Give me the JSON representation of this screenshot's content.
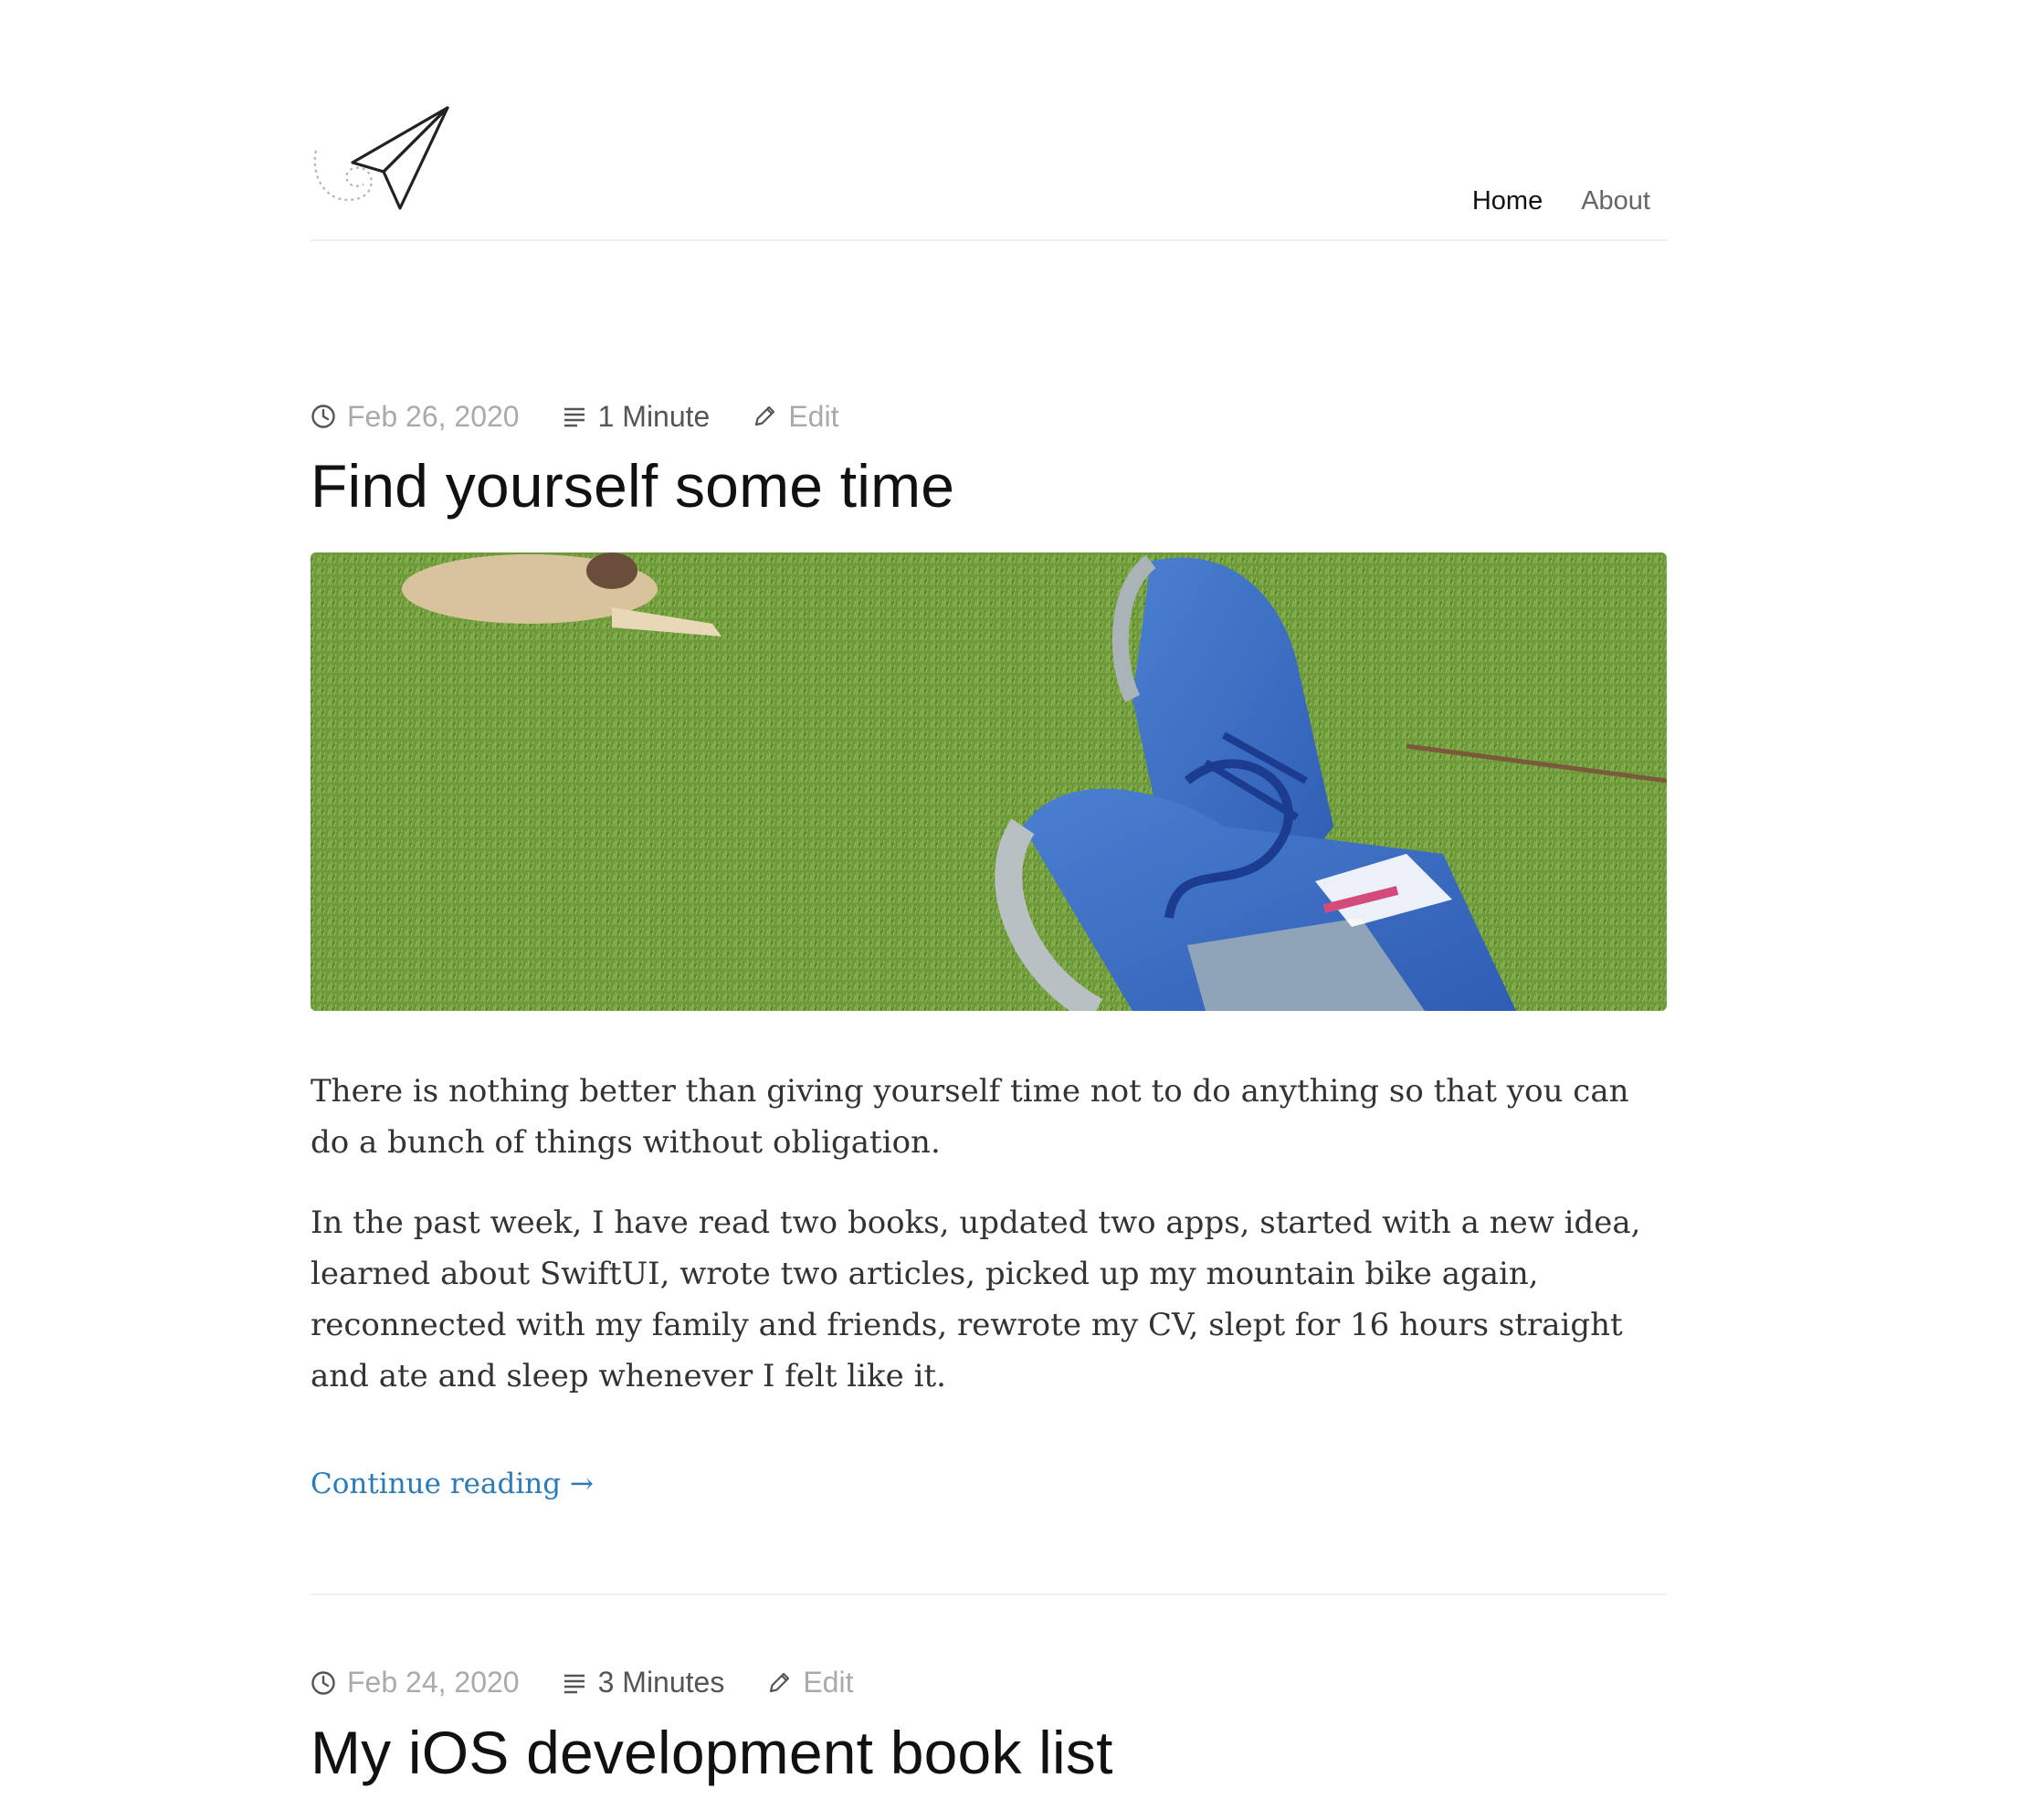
{
  "nav": {
    "home_label": "Home",
    "about_label": "About"
  },
  "posts": [
    {
      "date": "Feb 26, 2020",
      "read_time": "1 Minute",
      "edit_label": "Edit",
      "title": "Find yourself some time",
      "paragraphs": [
        "There is nothing better than giving yourself time not to do anything so that you can do a bunch of things without obligation.",
        "In the past week, I have read two books, updated two apps, started with a new idea, learned about SwiftUI, wrote two articles, picked up my mountain bike again, reconnected with my family and friends, rewrote my CV, slept for 16 hours straight and ate and sleep whenever I felt like it."
      ],
      "continue_label": "Continue reading →"
    },
    {
      "date": "Feb 24, 2020",
      "read_time": "3 Minutes",
      "edit_label": "Edit",
      "title": "My iOS development book list"
    }
  ],
  "colors": {
    "accent_link": "#2b7bb9",
    "meta_text": "#aaaaaa",
    "divider": "#efefef"
  }
}
